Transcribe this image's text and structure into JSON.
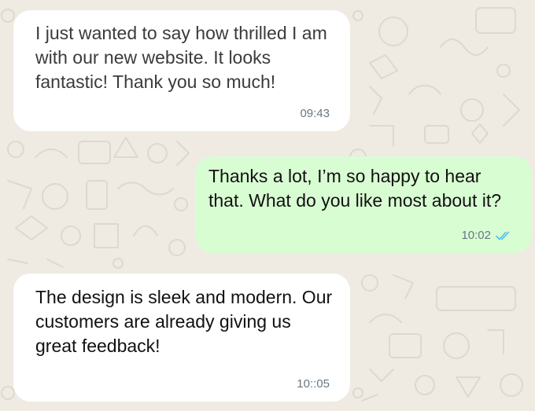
{
  "chat": {
    "background_color": "#efeae2",
    "incoming_bubble_color": "#ffffff",
    "outgoing_bubble_color": "#d9fdd3",
    "read_receipt_color": "#53bdeb",
    "messages": [
      {
        "direction": "incoming",
        "text": "I just wanted to say how thrilled I am with our new website. It looks fantastic! Thank you so much!",
        "time": "09:43"
      },
      {
        "direction": "outgoing",
        "text": "Thanks a lot, I’m so happy to hear that. What do you like most about it?",
        "time": "10:02",
        "status_icon": "double-check-icon"
      },
      {
        "direction": "incoming",
        "text": "The design is sleek and modern. Our customers are already giving us great feedback!",
        "time": "10::05"
      }
    ]
  }
}
